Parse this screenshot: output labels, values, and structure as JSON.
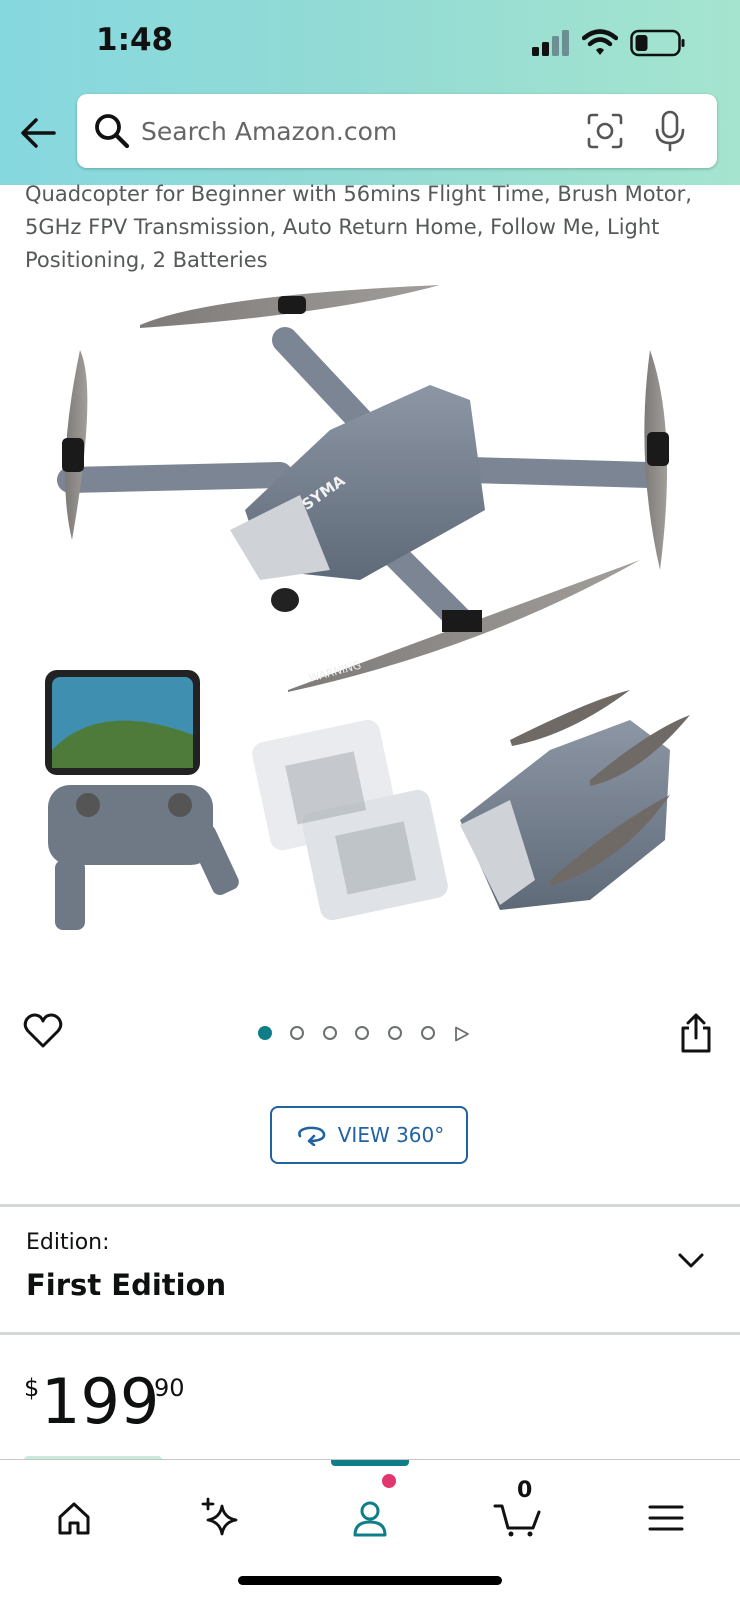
{
  "status_bar": {
    "time": "1:48"
  },
  "search": {
    "placeholder": "Search Amazon.com"
  },
  "product": {
    "title": "Quadcopter for Beginner with 56mins Flight Time, Brush Motor, 5GHz FPV Transmission, Auto Return Home, Follow Me, Light Positioning, 2 Batteries",
    "image_brand_text": "SYMA",
    "image_warning_text": "WARNING",
    "image_count": 6,
    "active_image_index": 1,
    "view360_label": "VIEW 360°"
  },
  "edition": {
    "label": "Edition:",
    "value": "First Edition"
  },
  "price": {
    "symbol": "$",
    "whole": "199",
    "fraction": "90"
  },
  "bottom_nav": {
    "items": [
      "home",
      "rufus",
      "account",
      "cart",
      "menu"
    ],
    "active": "account",
    "cart_count": "0"
  },
  "colors": {
    "accent": "#0f7e89",
    "link": "#2162a1",
    "badge": "#e2366e"
  }
}
